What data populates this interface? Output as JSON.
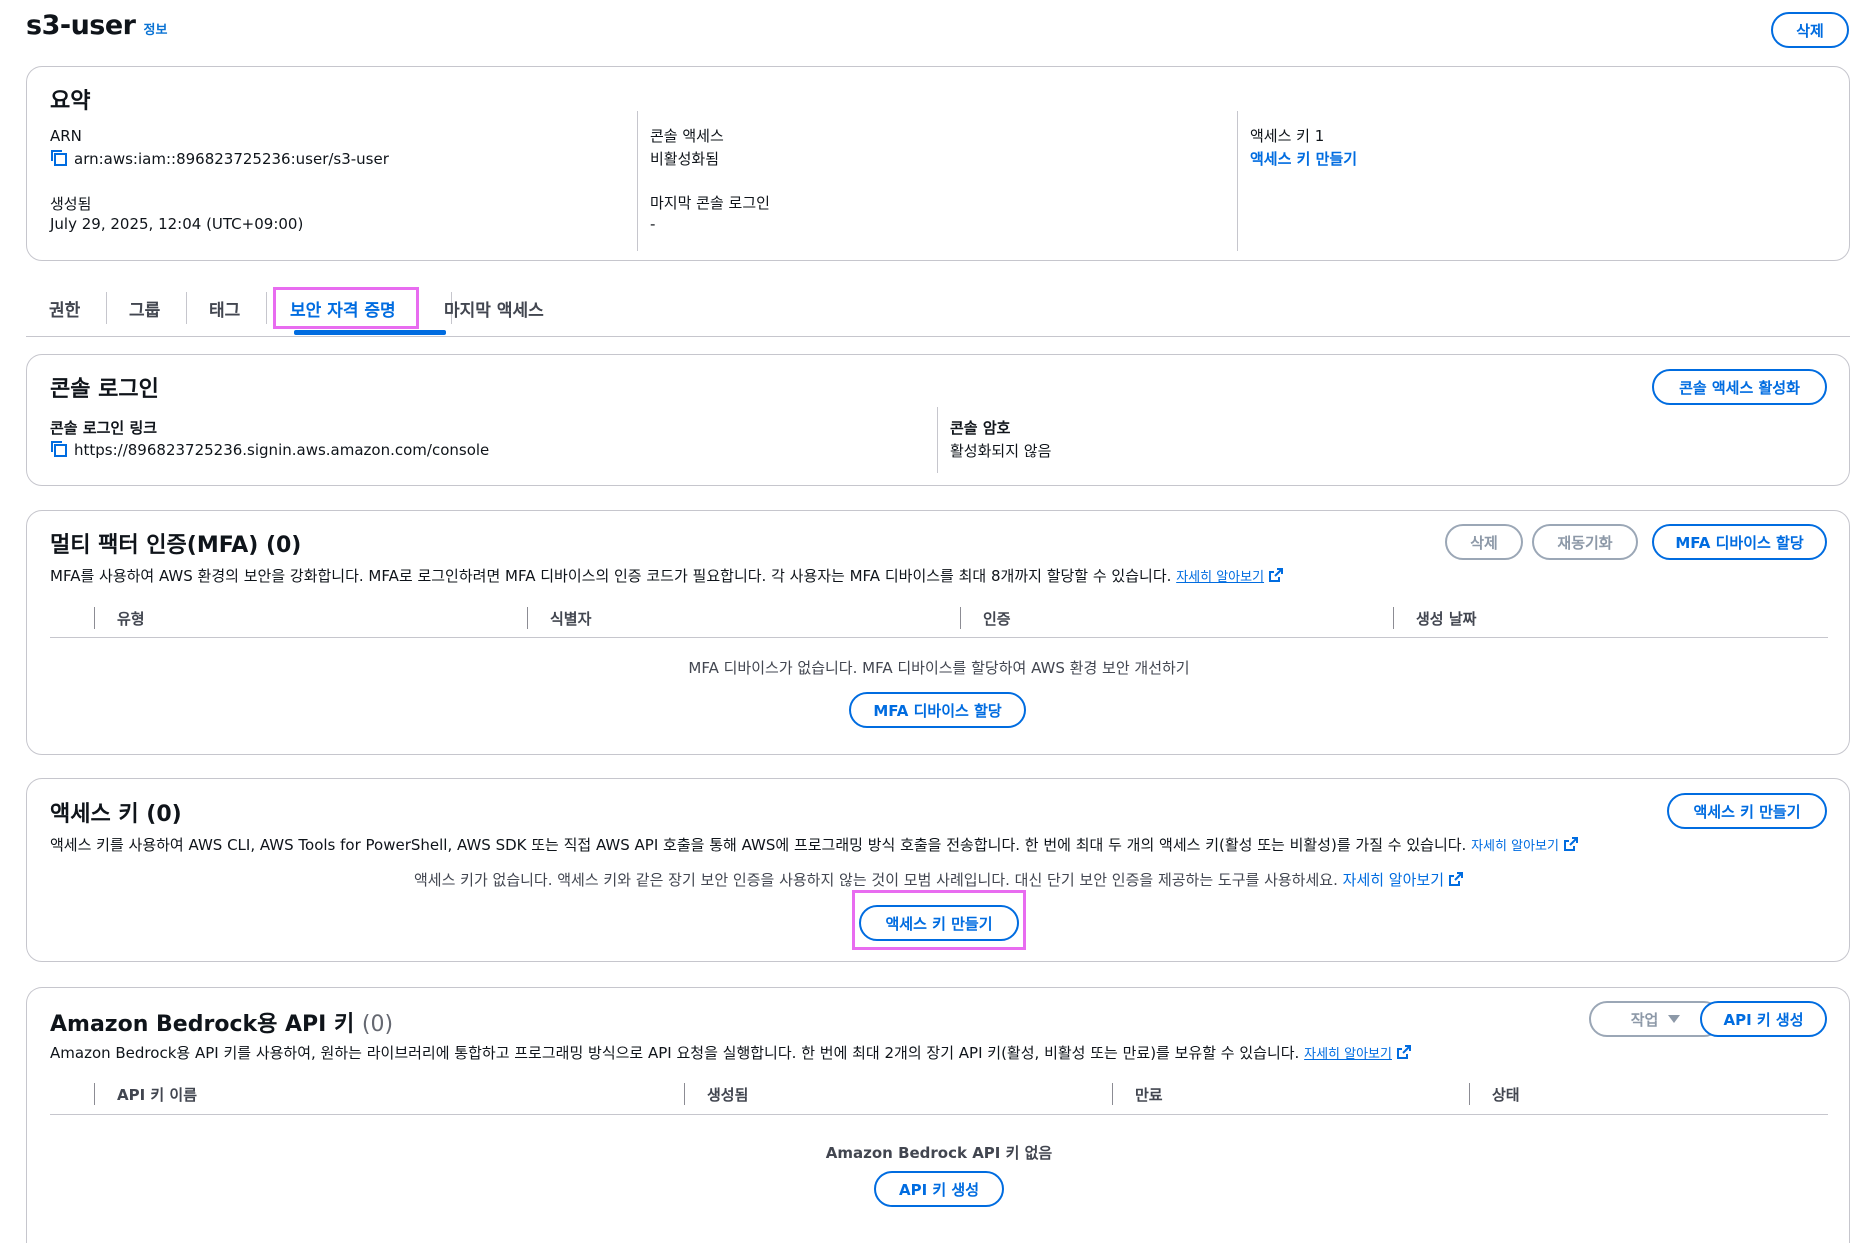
{
  "header": {
    "title": "s3-user",
    "info": "정보",
    "delete_button": "삭제"
  },
  "summary": {
    "heading": "요약",
    "arn_label": "ARN",
    "arn_value": "arn:aws:iam::896823725236:user/s3-user",
    "created_label": "생성됨",
    "created_value": "July 29, 2025, 12:04 (UTC+09:00)",
    "console_access_label": "콘솔 액세스",
    "console_access_value": "비활성화됨",
    "last_console_login_label": "마지막 콘솔 로그인",
    "last_console_login_value": "-",
    "access_key1_label": "액세스 키 1",
    "access_key1_link": "액세스 키 만들기"
  },
  "tabs": [
    {
      "label": "권한"
    },
    {
      "label": "그룹"
    },
    {
      "label": "태그"
    },
    {
      "label": "보안 자격 증명",
      "active": true
    },
    {
      "label": "마지막 액세스"
    }
  ],
  "console_login": {
    "heading": "콘솔 로그인",
    "enable_button": "콘솔 액세스 활성화",
    "link_label": "콘솔 로그인 링크",
    "link_value": "https://896823725236.signin.aws.amazon.com/console",
    "password_label": "콘솔 암호",
    "password_value": "활성화되지 않음"
  },
  "mfa": {
    "heading": "멀티 팩터 인증(MFA) (0)",
    "delete_button": "삭제",
    "resync_button": "재동기화",
    "assign_button": "MFA 디바이스 할당",
    "description": "MFA를 사용하여 AWS 환경의 보안을 강화합니다. MFA로 로그인하려면 MFA 디바이스의 인증 코드가 필요합니다. 각 사용자는 MFA 디바이스를 최대 8개까지 할당할 수 있습니다.",
    "learn_more": "자세히 알아보기",
    "columns": [
      "유형",
      "식별자",
      "인증",
      "생성 날짜"
    ],
    "empty_message": "MFA 디바이스가 없습니다. MFA 디바이스를 할당하여 AWS 환경 보안 개선하기",
    "empty_button": "MFA 디바이스 할당"
  },
  "access_keys": {
    "heading": "액세스 키 (0)",
    "create_button": "액세스 키 만들기",
    "description": "액세스 키를 사용하여 AWS CLI, AWS Tools for PowerShell, AWS SDK 또는 직접 AWS API 호출을 통해 AWS에 프로그래밍 방식 호출을 전송합니다. 한 번에 최대 두 개의 액세스 키(활성 또는 비활성)를 가질 수 있습니다.",
    "learn_more": "자세히 알아보기",
    "empty_message": "액세스 키가 없습니다. 액세스 키와 같은 장기 보안 인증을 사용하지 않는 것이 모범 사례입니다. 대신 단기 보안 인증을 제공하는 도구를 사용하세요.",
    "empty_learn_more": "자세히 알아보기",
    "empty_button": "액세스 키 만들기"
  },
  "bedrock": {
    "heading": "Amazon Bedrock용 API 키",
    "count": "(0)",
    "actions_button": "작업",
    "generate_button": "API 키 생성",
    "description": "Amazon Bedrock용 API 키를 사용하여, 원하는 라이브러리에 통합하고 프로그래밍 방식으로 API 요청을 실행합니다. 한 번에 최대 2개의 장기 API 키(활성, 비활성 또는 만료)를 보유할 수 있습니다.",
    "learn_more": "자세히 알아보기",
    "columns": [
      "API 키 이름",
      "생성됨",
      "만료",
      "상태"
    ],
    "empty_message": "Amazon Bedrock API 키 없음",
    "empty_button": "API 키 생성"
  },
  "colors": {
    "accent": "#006ce0",
    "highlight": "#e86cf0",
    "border": "#c6c6cd"
  }
}
